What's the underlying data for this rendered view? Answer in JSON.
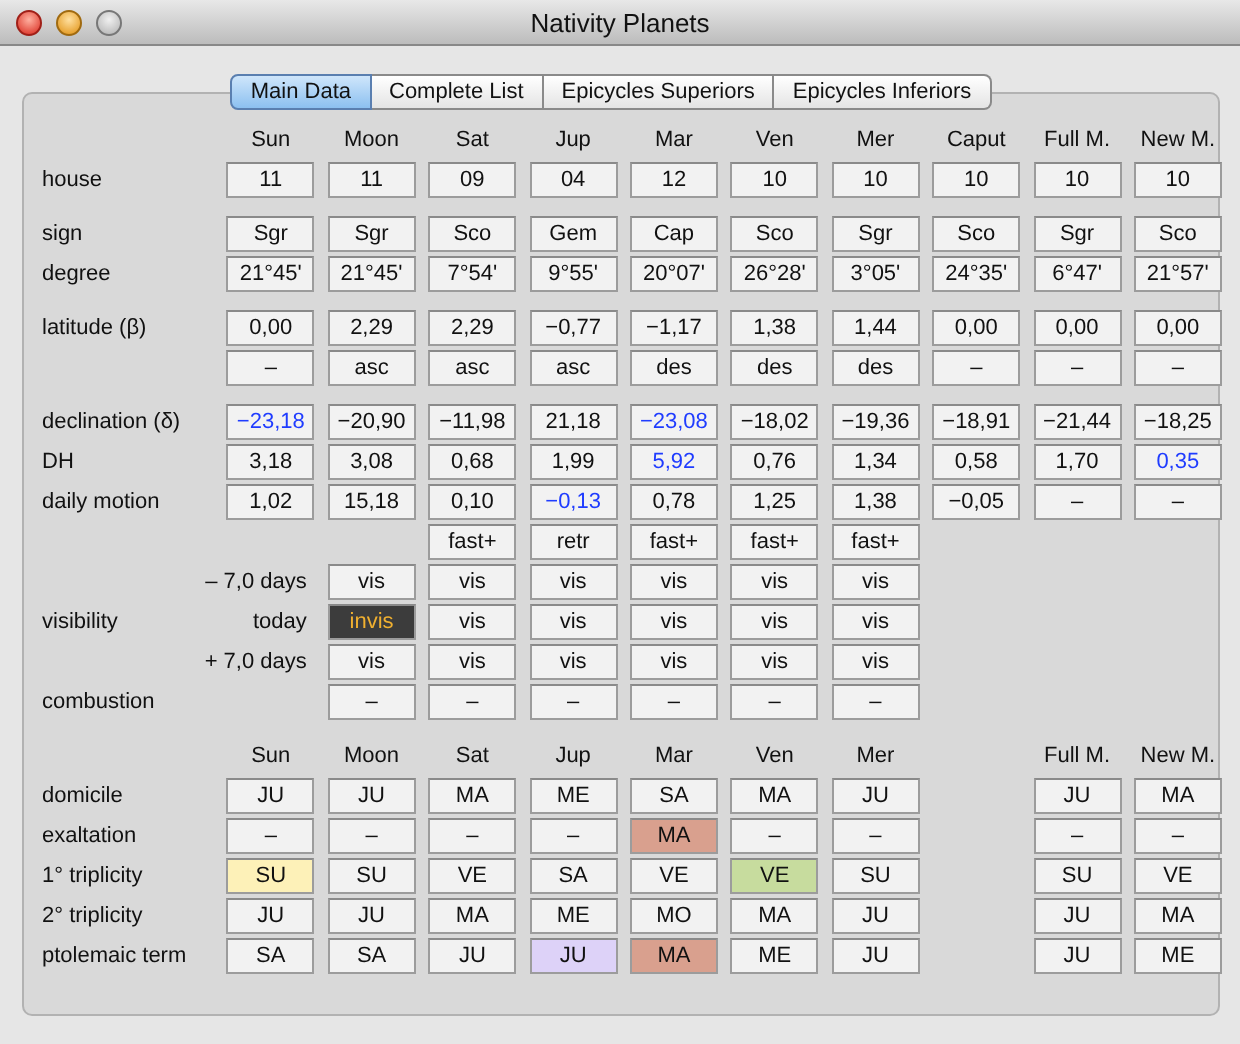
{
  "window": {
    "title": "Nativity Planets"
  },
  "tabs": [
    {
      "label": "Main Data",
      "selected": true
    },
    {
      "label": "Complete List",
      "selected": false
    },
    {
      "label": "Epicycles Superiors",
      "selected": false
    },
    {
      "label": "Epicycles Inferiors",
      "selected": false
    }
  ],
  "sections": [
    {
      "rows": [
        {
          "kind": "header",
          "columns": [
            "Sun",
            "Moon",
            "Sat",
            "Jup",
            "Mar",
            "Ven",
            "Mer",
            "Caput",
            "Full M.",
            "New M."
          ]
        },
        {
          "kind": "values",
          "label": "house",
          "cells": [
            "11",
            "11",
            "09",
            "04",
            "12",
            "10",
            "10",
            "10",
            "10",
            "10"
          ]
        }
      ]
    },
    {
      "rows": [
        {
          "kind": "values",
          "label": "sign",
          "cells": [
            "Sgr",
            "Sgr",
            "Sco",
            "Gem",
            "Cap",
            "Sco",
            "Sgr",
            "Sco",
            "Sgr",
            "Sco"
          ]
        },
        {
          "kind": "values",
          "label": "degree",
          "cells": [
            "21°45'",
            "21°45'",
            "7°54'",
            "9°55'",
            "20°07'",
            "26°28'",
            "3°05'",
            "24°35'",
            "6°47'",
            "21°57'"
          ]
        }
      ]
    },
    {
      "rows": [
        {
          "kind": "values",
          "label": "latitude (β)",
          "cells": [
            "0,00",
            "2,29",
            "2,29",
            "−0,77",
            "−1,17",
            "1,38",
            "1,44",
            "0,00",
            "0,00",
            "0,00"
          ]
        },
        {
          "kind": "values",
          "cells": [
            "–",
            "asc",
            "asc",
            "asc",
            "des",
            "des",
            "des",
            "–",
            "–",
            "–"
          ]
        }
      ]
    },
    {
      "rows": [
        {
          "kind": "values",
          "label": "declination (δ)",
          "cells": [
            {
              "text": "−23,18",
              "emphasis": true
            },
            "−20,90",
            "−11,98",
            "21,18",
            {
              "text": "−23,08",
              "emphasis": true
            },
            "−18,02",
            "−19,36",
            "−18,91",
            "−21,44",
            "−18,25"
          ]
        },
        {
          "kind": "values",
          "label": "DH",
          "cells": [
            "3,18",
            "3,08",
            "0,68",
            "1,99",
            {
              "text": "5,92",
              "emphasis": true
            },
            "0,76",
            "1,34",
            "0,58",
            "1,70",
            {
              "text": "0,35",
              "emphasis": true
            }
          ]
        },
        {
          "kind": "values",
          "label": "daily motion",
          "cells": [
            "1,02",
            "15,18",
            "0,10",
            {
              "text": "−0,13",
              "emphasis": true
            },
            "0,78",
            "1,25",
            "1,38",
            "−0,05",
            "–",
            "–"
          ]
        },
        {
          "kind": "values",
          "cells": [
            null,
            null,
            "fast+",
            "retr",
            "fast+",
            "fast+",
            "fast+"
          ]
        },
        {
          "kind": "sub",
          "label": "– 7,0 days",
          "cells": [
            "vis",
            "vis",
            "vis",
            "vis",
            "vis",
            "vis"
          ]
        },
        {
          "kind": "sub",
          "group": "visibility",
          "label": "today",
          "cells": [
            {
              "text": "invis",
              "color": "#3c3c3c",
              "inverted": true
            },
            "vis",
            "vis",
            "vis",
            "vis",
            "vis"
          ]
        },
        {
          "kind": "sub",
          "label": "+ 7,0 days",
          "cells": [
            "vis",
            "vis",
            "vis",
            "vis",
            "vis",
            "vis"
          ]
        },
        {
          "kind": "values",
          "label": "combustion",
          "cells": [
            null,
            "–",
            "–",
            "–",
            "–",
            "–",
            "–"
          ]
        }
      ]
    },
    {
      "rows": [
        {
          "kind": "header",
          "columns": [
            "Sun",
            "Moon",
            "Sat",
            "Jup",
            "Mar",
            "Ven",
            "Mer",
            null,
            "Full M.",
            "New M."
          ]
        },
        {
          "kind": "values",
          "label": "domicile",
          "cells": [
            "JU",
            "JU",
            "MA",
            "ME",
            "SA",
            "MA",
            "JU",
            null,
            "JU",
            "MA"
          ]
        },
        {
          "kind": "values",
          "label": "exaltation",
          "cells": [
            "–",
            "–",
            "–",
            "–",
            {
              "text": "MA",
              "color": "#d9a08e"
            },
            "–",
            "–",
            null,
            "–",
            "–"
          ]
        },
        {
          "kind": "values",
          "label": "1° triplicity",
          "cells": [
            {
              "text": "SU",
              "color": "#fdf1b8"
            },
            "SU",
            "VE",
            "SA",
            "VE",
            {
              "text": "VE",
              "color": "#c7dc9e"
            },
            "SU",
            null,
            "SU",
            "VE"
          ]
        },
        {
          "kind": "values",
          "label": "2° triplicity",
          "cells": [
            "JU",
            "JU",
            "MA",
            "ME",
            "MO",
            "MA",
            "JU",
            null,
            "JU",
            "MA"
          ]
        },
        {
          "kind": "values",
          "label": "ptolemaic term",
          "cells": [
            "SA",
            "SA",
            "JU",
            {
              "text": "JU",
              "color": "#ddd2f8"
            },
            {
              "text": "MA",
              "color": "#d9a08e"
            },
            "ME",
            "JU",
            null,
            "JU",
            "ME"
          ]
        }
      ]
    }
  ]
}
